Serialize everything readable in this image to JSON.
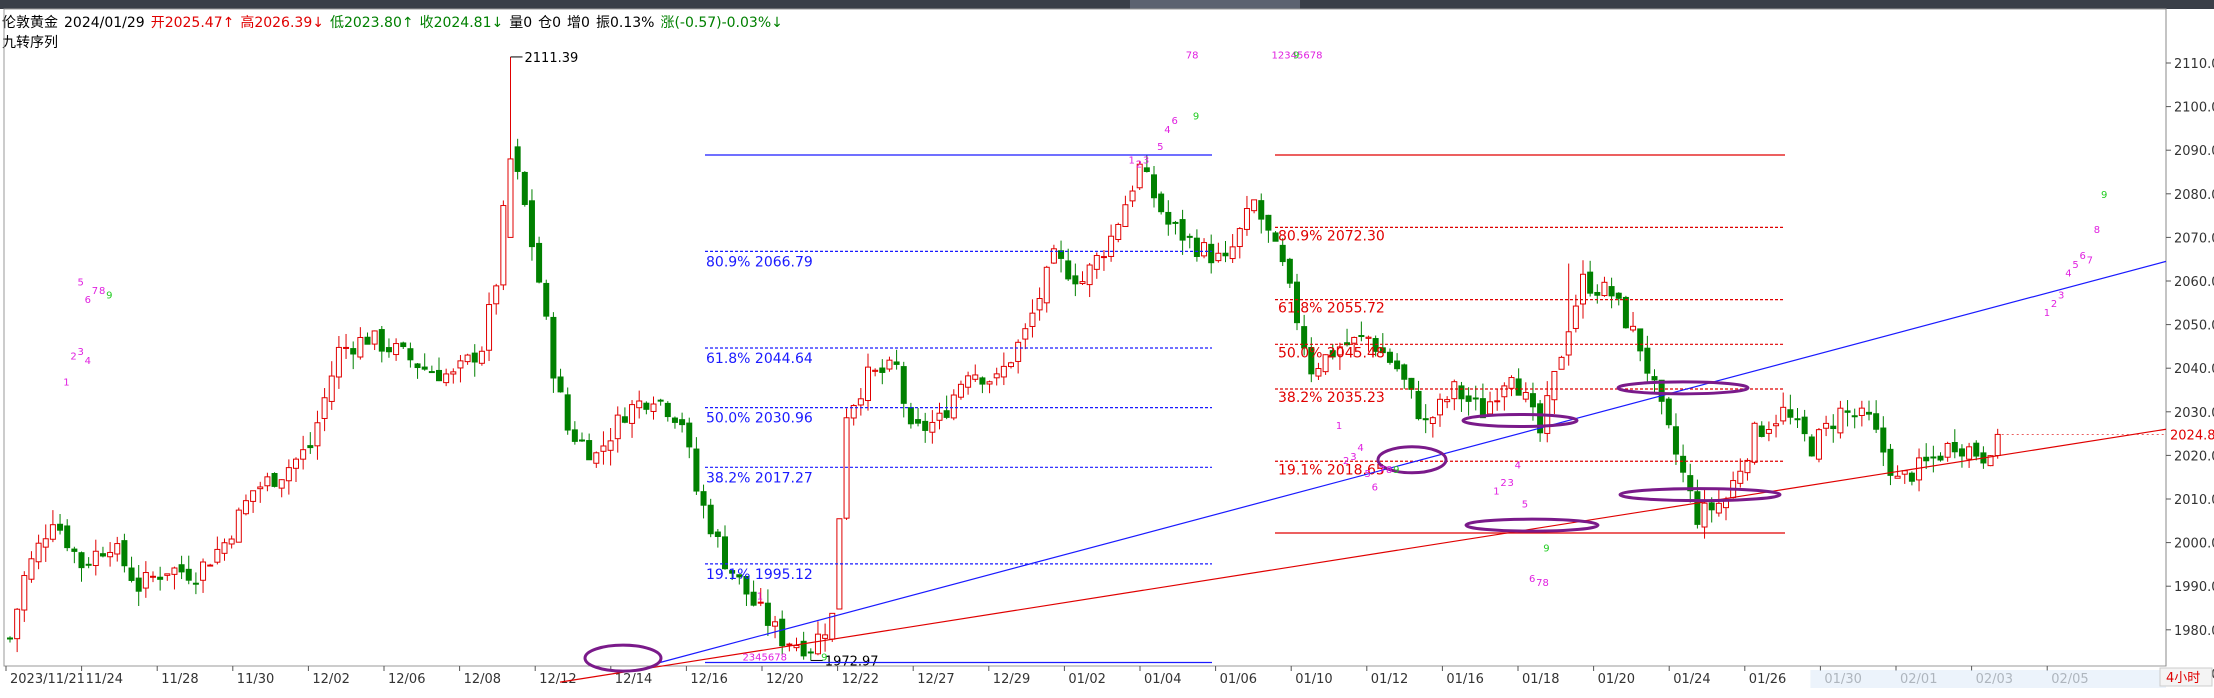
{
  "header": {
    "symbol": "伦敦黄金",
    "date": "2024/01/29",
    "open": "开2025.47↑",
    "high": "高2026.39↓",
    "low": "低2023.80↑",
    "close": "收2024.81↓",
    "volume": "量0",
    "position": "仓0",
    "increase": "增0",
    "amplitude": "振0.13%",
    "change": "涨(-0.57)-0.03%↓"
  },
  "indicator_name": "九转序列",
  "timeframe": "4小时",
  "last_price_label": "2024.81",
  "colors": {
    "up": "#e00000",
    "down": "#008000",
    "fib_blue": "#1a1aff",
    "fib_red": "#e00000",
    "ellipse": "#7a1a8a",
    "seq_magenta": "#e020e0",
    "seq_green": "#22cc22"
  },
  "chart_data": {
    "type": "candlestick",
    "ylim": [
      1966,
      2116
    ],
    "yticks": [
      "2110.00",
      "2100.00",
      "2090.00",
      "2080.00",
      "2070.00",
      "2060.00",
      "2050.00",
      "2040.00",
      "2030.00",
      "2020.00",
      "2010.00",
      "2000.00",
      "1990.00",
      "1980.00",
      "1970.00"
    ],
    "xticks": [
      "2023/11/21",
      "11/24",
      "11/28",
      "11/30",
      "12/02",
      "12/06",
      "12/08",
      "12/12",
      "12/14",
      "12/16",
      "12/20",
      "12/22",
      "12/27",
      "12/29",
      "01/02",
      "01/04",
      "01/06",
      "01/10",
      "01/12",
      "01/16",
      "01/18",
      "01/20",
      "01/24",
      "01/26",
      "01/30",
      "02/01",
      "02/03",
      "02/05"
    ],
    "price_path": [
      [
        0,
        1978
      ],
      [
        2,
        1992
      ],
      [
        6,
        2006
      ],
      [
        10,
        1995
      ],
      [
        14,
        2000
      ],
      [
        18,
        1990
      ],
      [
        22,
        1994
      ],
      [
        26,
        1993
      ],
      [
        30,
        2000
      ],
      [
        34,
        2012
      ],
      [
        38,
        2016
      ],
      [
        42,
        2022
      ],
      [
        46,
        2044
      ],
      [
        50,
        2047
      ],
      [
        54,
        2044
      ],
      [
        58,
        2040
      ],
      [
        62,
        2038
      ],
      [
        66,
        2045
      ],
      [
        68,
        2060
      ],
      [
        70,
        2090
      ],
      [
        72,
        2077
      ],
      [
        74,
        2060
      ],
      [
        76,
        2040
      ],
      [
        78,
        2026
      ],
      [
        82,
        2020
      ],
      [
        86,
        2030
      ],
      [
        90,
        2034
      ],
      [
        94,
        2028
      ],
      [
        96,
        2012
      ],
      [
        100,
        1996
      ],
      [
        104,
        1986
      ],
      [
        108,
        1978
      ],
      [
        112,
        1976
      ],
      [
        115,
        1983
      ],
      [
        117,
        2030
      ],
      [
        120,
        2038
      ],
      [
        124,
        2040
      ],
      [
        126,
        2025
      ],
      [
        130,
        2028
      ],
      [
        134,
        2040
      ],
      [
        138,
        2037
      ],
      [
        142,
        2048
      ],
      [
        146,
        2065
      ],
      [
        150,
        2060
      ],
      [
        154,
        2070
      ],
      [
        158,
        2086
      ],
      [
        162,
        2073
      ],
      [
        166,
        2068
      ],
      [
        170,
        2064
      ],
      [
        174,
        2078
      ],
      [
        178,
        2063
      ],
      [
        182,
        2040
      ],
      [
        186,
        2045
      ],
      [
        190,
        2047
      ],
      [
        194,
        2040
      ],
      [
        198,
        2027
      ],
      [
        202,
        2035
      ],
      [
        206,
        2030
      ],
      [
        210,
        2040
      ],
      [
        214,
        2025
      ],
      [
        218,
        2050
      ],
      [
        220,
        2060
      ],
      [
        224,
        2057
      ],
      [
        228,
        2045
      ],
      [
        232,
        2025
      ],
      [
        236,
        2006
      ],
      [
        240,
        2010
      ],
      [
        244,
        2025
      ],
      [
        248,
        2030
      ],
      [
        252,
        2022
      ],
      [
        256,
        2030
      ],
      [
        260,
        2028
      ],
      [
        264,
        2014
      ],
      [
        268,
        2018
      ],
      [
        272,
        2023
      ],
      [
        276,
        2020
      ],
      [
        278,
        2024.81
      ]
    ],
    "annotations": {
      "high": "2111.39",
      "low": "1972.97"
    },
    "fib_blue": [
      {
        "label": "80.9% 2066.79",
        "value": 2066.79
      },
      {
        "label": "61.8% 2044.64",
        "value": 2044.64
      },
      {
        "label": "50.0% 2030.96",
        "value": 2030.96
      },
      {
        "label": "38.2% 2017.27",
        "value": 2017.27
      },
      {
        "label": "19.1% 1995.12",
        "value": 1995.12
      }
    ],
    "fib_blue_top": 2088.9,
    "fib_blue_bottom": 1972.5,
    "fib_red": [
      {
        "label": "80.9% 2072.30",
        "value": 2072.3
      },
      {
        "label": "61.8% 2055.72",
        "value": 2055.72
      },
      {
        "label": "50.0% 2045.48",
        "value": 2045.48
      },
      {
        "label": "38.2% 2035.23",
        "value": 2035.23
      },
      {
        "label": "19.1% 2018.65",
        "value": 2018.65
      }
    ],
    "fib_red_top": 2088.9,
    "fib_red_bottom": 2002.2,
    "seq_labels": [
      {
        "t": "1",
        "x": 8,
        "v": 2036,
        "c": "m"
      },
      {
        "t": "2",
        "x": 9,
        "v": 2042,
        "c": "m"
      },
      {
        "t": "3",
        "x": 10,
        "v": 2043,
        "c": "m"
      },
      {
        "t": "4",
        "x": 11,
        "v": 2041,
        "c": "m"
      },
      {
        "t": "5",
        "x": 10,
        "v": 2059,
        "c": "m"
      },
      {
        "t": "6",
        "x": 11,
        "v": 2055,
        "c": "m"
      },
      {
        "t": "7",
        "x": 12,
        "v": 2057,
        "c": "m"
      },
      {
        "t": "8",
        "x": 13,
        "v": 2057,
        "c": "m"
      },
      {
        "t": "9",
        "x": 14,
        "v": 2056,
        "c": "g"
      },
      {
        "t": "1",
        "x": 105,
        "v": 1987,
        "c": "m"
      },
      {
        "t": "2345678",
        "x": 103,
        "v": 1973,
        "c": "m"
      },
      {
        "t": "9",
        "x": 114,
        "v": 1973,
        "c": "g"
      },
      {
        "t": "1",
        "x": 157,
        "v": 2087,
        "c": "m"
      },
      {
        "t": "2",
        "x": 158,
        "v": 2086,
        "c": "m"
      },
      {
        "t": "3",
        "x": 159,
        "v": 2087,
        "c": "m"
      },
      {
        "t": "4",
        "x": 162,
        "v": 2094,
        "c": "m"
      },
      {
        "t": "5",
        "x": 161,
        "v": 2090,
        "c": "m"
      },
      {
        "t": "6",
        "x": 163,
        "v": 2096,
        "c": "m"
      },
      {
        "t": "9",
        "x": 166,
        "v": 2097,
        "c": "g"
      },
      {
        "t": "78",
        "x": 165,
        "v": 2111,
        "c": "m"
      },
      {
        "t": "12345678",
        "x": 177,
        "v": 2111,
        "c": "m"
      },
      {
        "t": "9",
        "x": 180,
        "v": 2111,
        "c": "g"
      },
      {
        "t": "1",
        "x": 186,
        "v": 2026,
        "c": "m"
      },
      {
        "t": "2",
        "x": 187,
        "v": 2018,
        "c": "m"
      },
      {
        "t": "3",
        "x": 188,
        "v": 2019,
        "c": "m"
      },
      {
        "t": "4",
        "x": 189,
        "v": 2021,
        "c": "m"
      },
      {
        "t": "5",
        "x": 190,
        "v": 2015,
        "c": "m"
      },
      {
        "t": "6",
        "x": 191,
        "v": 2012,
        "c": "m"
      },
      {
        "t": "7",
        "x": 192,
        "v": 2016,
        "c": "m"
      },
      {
        "t": "8",
        "x": 193,
        "v": 2016,
        "c": "m"
      },
      {
        "t": "9",
        "x": 194,
        "v": 2016,
        "c": "g"
      },
      {
        "t": "1",
        "x": 208,
        "v": 2011,
        "c": "m"
      },
      {
        "t": "2",
        "x": 209,
        "v": 2013,
        "c": "m"
      },
      {
        "t": "3",
        "x": 210,
        "v": 2013,
        "c": "m"
      },
      {
        "t": "4",
        "x": 211,
        "v": 2017,
        "c": "m"
      },
      {
        "t": "5",
        "x": 212,
        "v": 2008,
        "c": "m"
      },
      {
        "t": "9",
        "x": 215,
        "v": 1998,
        "c": "g"
      },
      {
        "t": "6",
        "x": 213,
        "v": 1991,
        "c": "m"
      },
      {
        "t": "78",
        "x": 214,
        "v": 1990,
        "c": "m"
      },
      {
        "t": "1",
        "x": 285,
        "v": 2052,
        "c": "m"
      },
      {
        "t": "2",
        "x": 286,
        "v": 2054,
        "c": "m"
      },
      {
        "t": "3",
        "x": 287,
        "v": 2056,
        "c": "m"
      },
      {
        "t": "4",
        "x": 288,
        "v": 2061,
        "c": "m"
      },
      {
        "t": "5",
        "x": 289,
        "v": 2063,
        "c": "m"
      },
      {
        "t": "6",
        "x": 290,
        "v": 2065,
        "c": "m"
      },
      {
        "t": "7",
        "x": 291,
        "v": 2064,
        "c": "m"
      },
      {
        "t": "8",
        "x": 292,
        "v": 2071,
        "c": "m"
      },
      {
        "t": "9",
        "x": 293,
        "v": 2079,
        "c": "g"
      }
    ]
  }
}
